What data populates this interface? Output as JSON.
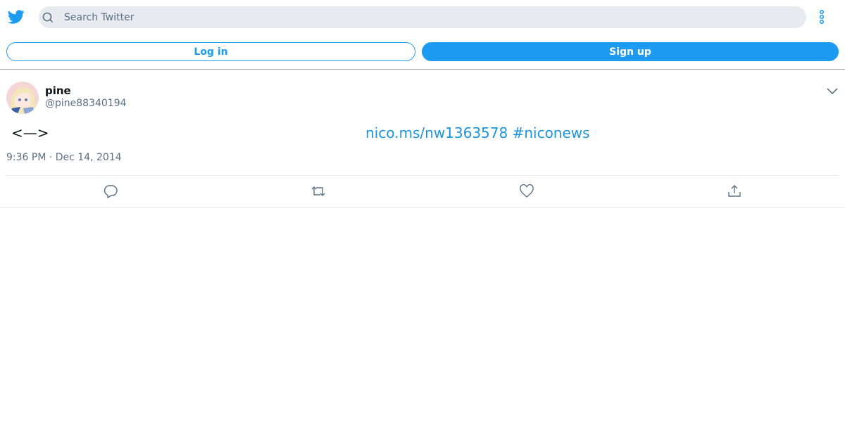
{
  "header": {
    "logo_icon": "twitter-bird-icon",
    "search_placeholder": "Search Twitter",
    "search_value": "",
    "more_icon": "more-vertical-icon"
  },
  "auth": {
    "login_label": "Log in",
    "signup_label": "Sign up"
  },
  "tweet": {
    "author_name": "pine",
    "author_handle": "@pine88340194",
    "body_text": "<—>",
    "link": "nico.ms/nw1363578",
    "hashtag": "#niconews",
    "timestamp": "9:36 PM · Dec 14, 2014",
    "actions": [
      "reply-icon",
      "retweet-icon",
      "like-icon",
      "share-icon"
    ]
  },
  "colors": {
    "brand": "#1d9bf0",
    "link": "#1b95e0",
    "muted_text": "#5b7083",
    "search_bg": "#e7eaee"
  }
}
